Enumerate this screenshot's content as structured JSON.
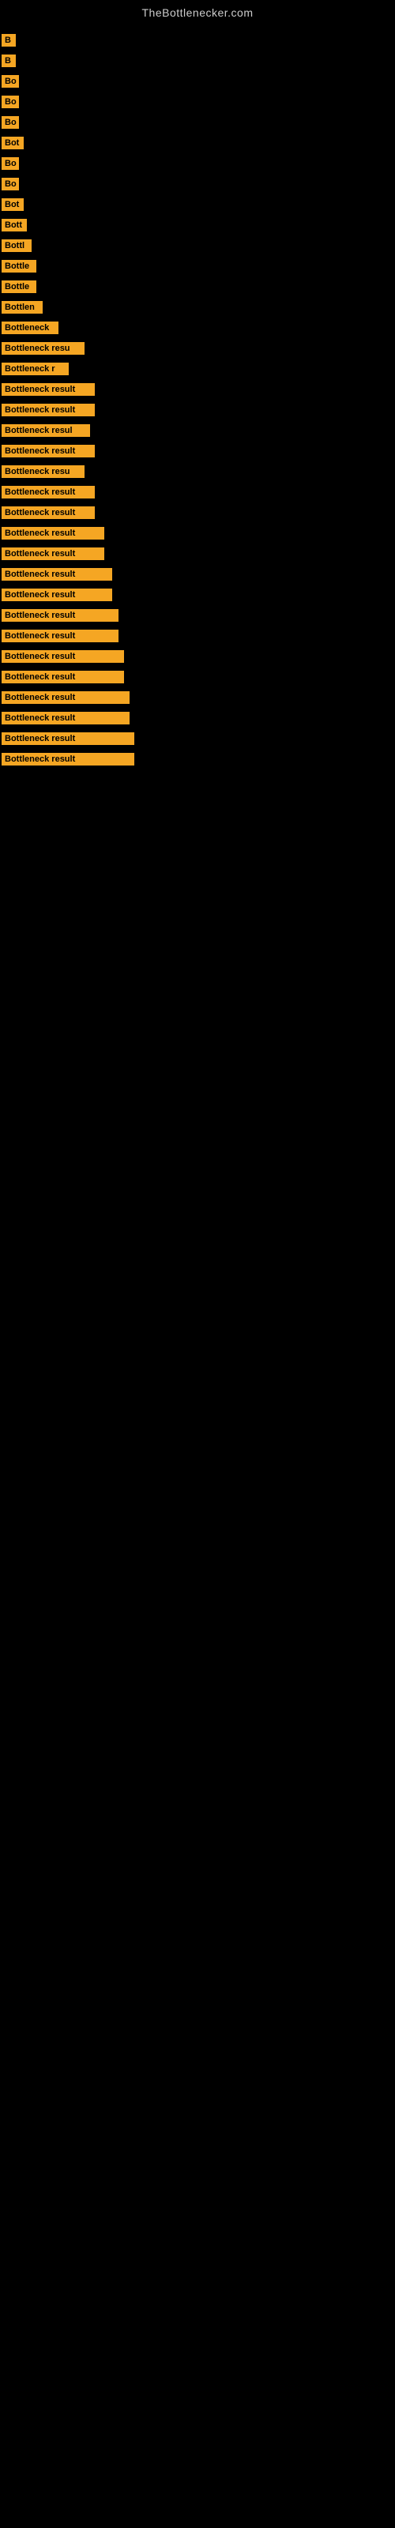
{
  "header": {
    "title": "TheBottlenecker.com"
  },
  "items": [
    {
      "label": "B",
      "width": 18
    },
    {
      "label": "B",
      "width": 18
    },
    {
      "label": "Bo",
      "width": 22
    },
    {
      "label": "Bo",
      "width": 22
    },
    {
      "label": "Bo",
      "width": 22
    },
    {
      "label": "Bot",
      "width": 28
    },
    {
      "label": "Bo",
      "width": 22
    },
    {
      "label": "Bo",
      "width": 22
    },
    {
      "label": "Bot",
      "width": 28
    },
    {
      "label": "Bott",
      "width": 32
    },
    {
      "label": "Bottl",
      "width": 38
    },
    {
      "label": "Bottle",
      "width": 44
    },
    {
      "label": "Bottle",
      "width": 44
    },
    {
      "label": "Bottlen",
      "width": 52
    },
    {
      "label": "Bottleneck",
      "width": 72
    },
    {
      "label": "Bottleneck resu",
      "width": 105
    },
    {
      "label": "Bottleneck r",
      "width": 85
    },
    {
      "label": "Bottleneck result",
      "width": 118
    },
    {
      "label": "Bottleneck result",
      "width": 118
    },
    {
      "label": "Bottleneck resul",
      "width": 112
    },
    {
      "label": "Bottleneck result",
      "width": 118
    },
    {
      "label": "Bottleneck resu",
      "width": 105
    },
    {
      "label": "Bottleneck result",
      "width": 118
    },
    {
      "label": "Bottleneck result",
      "width": 118
    },
    {
      "label": "Bottleneck result",
      "width": 130
    },
    {
      "label": "Bottleneck result",
      "width": 130
    },
    {
      "label": "Bottleneck result",
      "width": 140
    },
    {
      "label": "Bottleneck result",
      "width": 140
    },
    {
      "label": "Bottleneck result",
      "width": 148
    },
    {
      "label": "Bottleneck result",
      "width": 148
    },
    {
      "label": "Bottleneck result",
      "width": 155
    },
    {
      "label": "Bottleneck result",
      "width": 155
    },
    {
      "label": "Bottleneck result",
      "width": 162
    },
    {
      "label": "Bottleneck result",
      "width": 162
    },
    {
      "label": "Bottleneck result",
      "width": 168
    },
    {
      "label": "Bottleneck result",
      "width": 168
    }
  ]
}
